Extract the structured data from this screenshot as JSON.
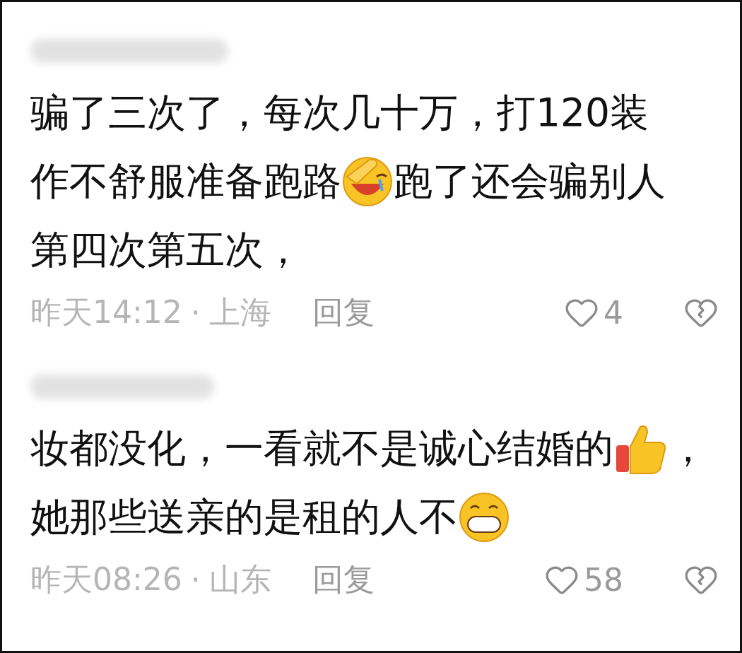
{
  "comments": [
    {
      "lines": [
        [
          {
            "kind": "text",
            "text": "骗了三次了，每次几十万，打120装"
          }
        ],
        [
          {
            "kind": "text",
            "text": "作不舒服准备跑路"
          },
          {
            "kind": "facepalm"
          },
          {
            "kind": "text",
            "text": "跑了还会骗别人"
          }
        ],
        [
          {
            "kind": "text",
            "text": "第四次第五次，"
          }
        ]
      ],
      "time": "昨天14:12",
      "separator": "·",
      "location": "上海",
      "reply": "回复",
      "likes": "4"
    },
    {
      "lines": [
        [
          {
            "kind": "text",
            "text": "妆都没化，一看就不是诚心结婚的"
          },
          {
            "kind": "thumbsup"
          },
          {
            "kind": "text",
            "text": "，"
          }
        ],
        [
          {
            "kind": "text",
            "text": "她那些送亲的是租的人不"
          },
          {
            "kind": "grin"
          }
        ]
      ],
      "time": "昨天08:26",
      "separator": "·",
      "location": "山东",
      "reply": "回复",
      "likes": "58"
    }
  ]
}
